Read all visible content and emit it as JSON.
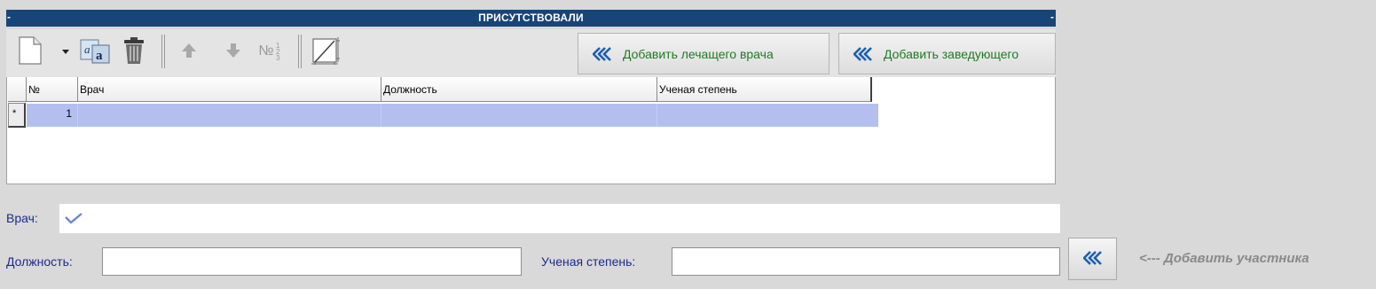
{
  "section": {
    "title": "ПРИСУТСТВОВАЛИ",
    "left_marker": "-",
    "right_marker": "-"
  },
  "toolbar": {
    "icons": [
      "new-document-icon",
      "dropdown-arrow-icon",
      "font-case-icon",
      "trash-icon",
      "arrow-up-icon",
      "arrow-down-icon",
      "numbering-icon",
      "edit-frame-icon"
    ],
    "numbering_glyph": "№",
    "add_attending_label": "Добавить лечащего врача",
    "add_head_label": "Добавить заведующего",
    "accent_green": "#1e7a24",
    "chevron_blue": "#1c5fb4"
  },
  "grid": {
    "columns": [
      "№",
      "Врач",
      "Должность",
      "Ученая степень"
    ],
    "rows": [
      {
        "marker": "*",
        "num": "1",
        "doctor": "",
        "position": "",
        "degree": ""
      }
    ],
    "selected_row_color": "#b4bff0"
  },
  "form": {
    "doctor_label": "Врач:",
    "position_label": "Должность:",
    "position_value": "",
    "degree_label": "Ученая степень:",
    "degree_value": "",
    "add_participant_hint": "<--- Добавить участника"
  },
  "colors": {
    "header_bg": "#17457a",
    "label_text": "#1d2a8a",
    "page_bg": "#d9d9d9"
  }
}
